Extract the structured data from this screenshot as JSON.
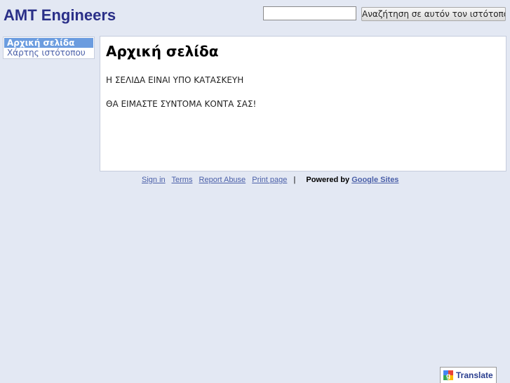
{
  "header": {
    "site_title": "AMT Engineers",
    "search_button_label": "Αναζήτηση σε αυτόν τον ιστότοπο",
    "search_value": ""
  },
  "sidebar": {
    "items": [
      {
        "label": "Αρχική σελίδα",
        "active": true
      },
      {
        "label": "Χάρτης ιστότοπου",
        "active": false
      }
    ]
  },
  "main": {
    "title": "Αρχική σελίδα",
    "lines": [
      "Η ΣΕΛΙΔΑ ΕΙΝΑΙ ΥΠΟ ΚΑΤΑΣΚΕΥΗ",
      "ΘΑ ΕΙΜΑΣΤΕ ΣΥΝΤΟΜΑ ΚΟΝΤΑ ΣΑΣ!"
    ]
  },
  "footer": {
    "links": [
      "Sign in",
      "Terms",
      "Report Abuse",
      "Print page"
    ],
    "separator": "|",
    "powered_by": "Powered by",
    "google_sites": "Google Sites"
  },
  "translate": {
    "label": "Translate",
    "icon": "google-g-icon"
  },
  "colors": {
    "background": "#e3e8f3",
    "title": "#2a2f88",
    "nav_active": "#6b9cdf",
    "link": "#4a5fa8"
  }
}
